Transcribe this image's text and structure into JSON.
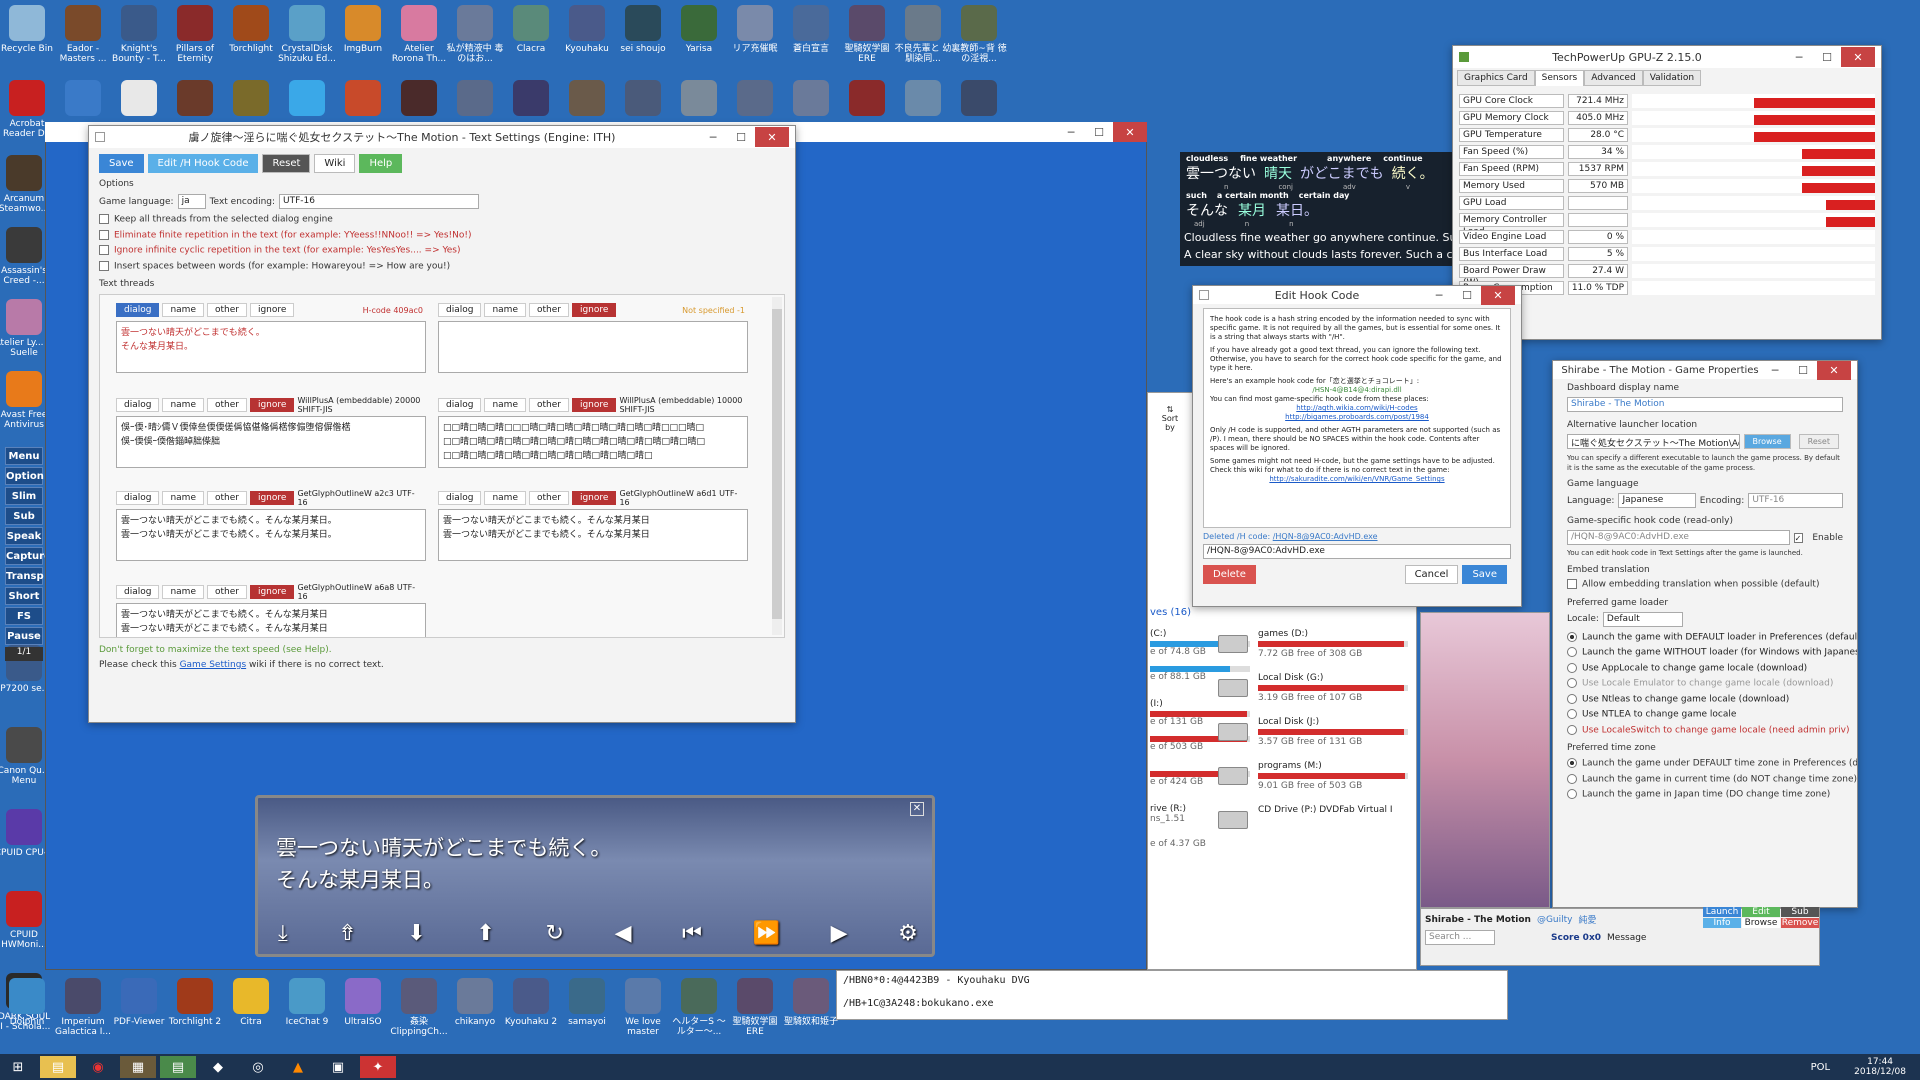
{
  "desktop": {
    "icons_top": [
      {
        "label": "Recycle Bin",
        "color": "#8fb8d8"
      },
      {
        "label": "Eador - Masters ...",
        "color": "#7a4a2a"
      },
      {
        "label": "Knight's Bounty - T...",
        "color": "#3a5a8a"
      },
      {
        "label": "Pillars of Eternity",
        "color": "#8a2a2a"
      },
      {
        "label": "Torchlight",
        "color": "#a04a1a"
      },
      {
        "label": "CrystalDisk Shizuku Ed...",
        "color": "#5aa0c8"
      },
      {
        "label": "ImgBurn",
        "color": "#d88a2a"
      },
      {
        "label": "Atelier Rorona Th...",
        "color": "#d87aa0"
      },
      {
        "label": "私が精液中 毒のはお...",
        "color": "#6a7a9a"
      },
      {
        "label": "Clacra",
        "color": "#5a8a7a"
      },
      {
        "label": "Kyouhaku",
        "color": "#4a5a8a"
      },
      {
        "label": "sei shoujo",
        "color": "#2a4a5a"
      },
      {
        "label": "Yarisa",
        "color": "#3a6a3a"
      },
      {
        "label": "リア充催眠",
        "color": "#7a8aaa"
      },
      {
        "label": "蒼白宣言",
        "color": "#4a6a9a"
      },
      {
        "label": "聖騎奴学園 ERE",
        "color": "#5a4a6a"
      },
      {
        "label": "不良先輩と 幼馴染同...",
        "color": "#6a7a8a"
      },
      {
        "label": "裏教師~背 徳の淫視...",
        "color": "#5a6a4a"
      }
    ],
    "icons_row2": [
      {
        "label": "Acrobat Reader DC",
        "color": "#c82020"
      },
      {
        "label": "",
        "color": "#3a7ac8"
      },
      {
        "label": "",
        "color": "#e8e8e8"
      },
      {
        "label": "",
        "color": "#6a3a2a"
      },
      {
        "label": "",
        "color": "#7a6a2a"
      },
      {
        "label": "",
        "color": "#3aa8e8"
      },
      {
        "label": "",
        "color": "#c84a2a"
      },
      {
        "label": "",
        "color": "#4a2a2a"
      },
      {
        "label": "",
        "color": "#5a6a8a"
      },
      {
        "label": "",
        "color": "#3a3a6a"
      },
      {
        "label": "",
        "color": "#6a5a4a"
      },
      {
        "label": "",
        "color": "#4a5a7a"
      },
      {
        "label": "",
        "color": "#7a8a9a"
      },
      {
        "label": "",
        "color": "#5a6a8a"
      },
      {
        "label": "",
        "color": "#6a7a9a"
      },
      {
        "label": "",
        "color": "#8a2a2a"
      },
      {
        "label": "",
        "color": "#6a8aaa"
      },
      {
        "label": "",
        "color": "#3a4a6a"
      }
    ],
    "icons_left": [
      {
        "label": "Arcanum Steamwo...",
        "color": "#4a3a2a"
      },
      {
        "label": "Assassin's Creed -...",
        "color": "#3a3a3a"
      },
      {
        "label": "Atelier Ly... & Suelle",
        "color": "#b87aa8"
      },
      {
        "label": "Avast Free Antivirus",
        "color": "#e87a1a"
      }
    ],
    "icons_left2": [
      {
        "label": "iP7200 se...",
        "color": "#3a5a8a"
      },
      {
        "label": "Canon Qu... Menu",
        "color": "#4a4a4a"
      },
      {
        "label": "CPUID CPU-Z",
        "color": "#5a3aa8"
      },
      {
        "label": "CPUID HWMoni...",
        "color": "#c82020"
      },
      {
        "label": "DARK SOUL II - Schola...",
        "color": "#2a2a2a"
      }
    ],
    "icons_bottom": [
      {
        "label": "Dolphin",
        "color": "#3a8ac8"
      },
      {
        "label": "Imperium Galactica I...",
        "color": "#4a4a6a"
      },
      {
        "label": "PDF-Viewer",
        "color": "#3a6ab8"
      },
      {
        "label": "Torchlight 2",
        "color": "#a03a1a"
      },
      {
        "label": "Citra",
        "color": "#e8b82a"
      },
      {
        "label": "IceChat 9",
        "color": "#4a9ac8"
      },
      {
        "label": "UltraISO",
        "color": "#8a6ac8"
      },
      {
        "label": "姦染 ClippingCh...",
        "color": "#5a5a7a"
      },
      {
        "label": "chikanyo",
        "color": "#6a7a9a"
      },
      {
        "label": "Kyouhaku 2",
        "color": "#4a5a8a"
      },
      {
        "label": "samayoi",
        "color": "#3a6a8a"
      },
      {
        "label": "We love master",
        "color": "#5a7aaa"
      },
      {
        "label": "ヘルターS 〜ルター〜...",
        "color": "#4a6a5a"
      },
      {
        "label": "聖騎奴学園 ERE",
        "color": "#5a4a6a"
      },
      {
        "label": "聖騎奴和姫子",
        "color": "#6a5a7a"
      }
    ],
    "sidebar": [
      "Menu",
      "Option",
      "Slim",
      "Sub",
      "Speak",
      "Capture",
      "Transp",
      "Short",
      "FS",
      "Pause"
    ],
    "sidebar_page": "1/1"
  },
  "textwin": {
    "title": "虜ノ旋律〜淫らに喘ぐ処女セクステット〜The Motion - Text Settings (Engine: ITH)",
    "toolbar": [
      "Save",
      "Edit /H Hook Code",
      "Reset",
      "Wiki",
      "Help"
    ],
    "options_label": "Options",
    "lang_label": "Game language:",
    "lang_val": "ja",
    "enc_label": "Text encoding:",
    "enc_val": "UTF-16",
    "checks": [
      "Keep all threads from the selected dialog engine",
      "Eliminate finite repetition in the text (for example: YYeess!!NNoo!! => Yes!No!)",
      "Ignore infinite cyclic repetition in the text (for example: YesYesYes.... => Yes)",
      "Insert spaces between words (for example: Howareyou! => How are you!)"
    ],
    "threads_label": "Text threads",
    "tabs": [
      "dialog",
      "name",
      "other",
      "ignore"
    ],
    "threads": [
      {
        "src": "H-code 409ac0",
        "lines": [
          "雲一つない晴天がどこまでも続く。",
          "そんな某月某日。"
        ],
        "red": true
      },
      {
        "src": "Not specified -1",
        "lines": [],
        "red": false
      },
      {
        "src": "WillPlusA (embeddable) 20000 SHIFT-JIS",
        "lines": [
          "俁ｰ偄･晴ｼ儔Ｖ偄倖亝偄偄傞偁恊偡偹偁楛偧傓堕傛偋偺楛",
          "俁ｰ偄俁ｰ偄偺錙晫胐偨胐"
        ],
        "red": false
      },
      {
        "src": "WillPlusA (embeddable) 10000 SHIFT-JIS",
        "lines": [
          "□□晴□晴□晴□□□晴□晴□晴□晴□晴□晴□晴□晴□□□晴□",
          "□□晴□晴□晴□晴□晴□晴□晴□晴□晴□晴□晴□晴□晴□晴□",
          "□□晴□晴□晴□晴□晴□晴□晴□晴□晴□晴□晴□"
        ],
        "red": false
      },
      {
        "src": "GetGlyphOutlineW a2c3 UTF-16",
        "lines": [
          "雲一つない晴天がどこまでも続く。そんな某月某日。",
          "雲一つない晴天がどこまでも続く。そんな某月某日。"
        ],
        "red": false
      },
      {
        "src": "GetGlyphOutlineW a6d1 UTF-16",
        "lines": [
          "雲一つない晴天がどこまでも続く。そんな某月某日",
          "雲一つない晴天がどこまでも続く。そんな某月某日"
        ],
        "red": false
      },
      {
        "src": "GetGlyphOutlineW a6a8 UTF-16",
        "lines": [
          "雲一つない晴天がどこまでも続く。そんな某月某日",
          "雲一つない晴天がどこまでも続く。そんな某月某日"
        ],
        "red": false
      }
    ],
    "foot1": "Don't forget to maximize the text speed (see Help).",
    "foot2a": "Please check this ",
    "foot2link": "Game Settings",
    "foot2b": " wiki if there is no correct text."
  },
  "game": {
    "line1": "雲一つない晴天がどこまでも続く。",
    "line2": "そんな某月某日。",
    "controls": [
      "⤓",
      "⇮",
      "⬇",
      "⬆",
      "↻",
      "◀",
      "⏮",
      "⏩",
      "▶",
      "⚙"
    ]
  },
  "overlay": {
    "ruby1": "cloudless",
    "ruby2": "fine weather",
    "ruby3": "anywhere",
    "ruby4": "continue",
    "jp1a": "雲一つない",
    "jp1b": "晴天",
    "jp1c": "がどこまでも",
    "jp1d": "続く。",
    "sub1": "n",
    "sub2": "conj",
    "sub3": "adv",
    "sub4": "v",
    "ruby5": "such",
    "ruby6": "a certain month",
    "ruby7": "certain day",
    "jp2a": "そんな",
    "jp2b": "某月",
    "jp2c": "某日。",
    "sub5": "adj",
    "sub6": "n",
    "sub7": "n",
    "tr1": "Cloudless fine weather go anywhere continue. Such a certain month certain day.",
    "tr2": "A clear sky without clouds lasts forever. Such a certain month certain day."
  },
  "gpuz": {
    "title": "TechPowerUp GPU-Z 2.15.0",
    "tabs": [
      "Graphics Card",
      "Sensors",
      "Advanced",
      "Validation"
    ],
    "rows": [
      {
        "n": "GPU Core Clock",
        "v": "721.4 MHz",
        "f": 0.5
      },
      {
        "n": "GPU Memory Clock",
        "v": "405.0 MHz",
        "f": 0.5
      },
      {
        "n": "GPU Temperature",
        "v": "28.0 °C",
        "f": 0.5
      },
      {
        "n": "Fan Speed (%)",
        "v": "34 %",
        "f": 0.3
      },
      {
        "n": "Fan Speed (RPM)",
        "v": "1537 RPM",
        "f": 0.3
      },
      {
        "n": "Memory Used",
        "v": "570 MB",
        "f": 0.3
      },
      {
        "n": "GPU Load",
        "v": "",
        "f": 0.2
      },
      {
        "n": "Memory Controller Load",
        "v": "",
        "f": 0.2
      },
      {
        "n": "Video Engine Load",
        "v": "0 %",
        "f": 0.0
      },
      {
        "n": "Bus Interface Load",
        "v": "5 %",
        "f": 0.0
      },
      {
        "n": "Board Power Draw (W)",
        "v": "27.4 W",
        "f": 0.0
      },
      {
        "n": "Power Consumption (%)",
        "v": "11.0 % TDP",
        "f": 0.0
      }
    ]
  },
  "hook": {
    "title": "Edit Hook Code",
    "p1": "The hook code is a hash string encoded by the information needed to sync with specific game. It is not required by all the games, but is essential for some ones. It is a string that always starts with \"/H\".",
    "p2": "If you have already got a good text thread, you can ignore the following text. Otherwise, you have to search for the correct hook code specific for the game, and type it here.",
    "p3": "Here's an example hook code for「恋と選挙とチョコレート」:",
    "p3code": "/HSN-4@B14@4:dirapi.dll",
    "p4": "You can find most game-specific hook code from these places:",
    "link1": "http://agth.wikia.com/wiki/H-codes",
    "link2": "http://bigames.proboards.com/post/1984",
    "p5": "Only /H code is supported, and other AGTH parameters are not supported (such as /P). I mean, there should be NO SPACES within the hook code. Contents after spaces will be ignored.",
    "p6": "Some games might not need H-code, but the game settings have to be adjusted. Check this wiki for what to do if there is no correct text in the game:",
    "link3": "http://sakuradite.com/wiki/en/VNR/Game_Settings",
    "deleted_label": "Deleted /H code:",
    "deleted_val": "/HQN-8@9AC0:AdvHD.exe",
    "code": "/HQN-8@9AC0:AdvHD.exe",
    "delete": "Delete",
    "cancel": "Cancel",
    "save": "Save"
  },
  "props": {
    "title": "Shirabe - The Motion - Game Properties",
    "display_label": "Dashboard display name",
    "display_val": "Shirabe - The Motion",
    "alt_label": "Alternative launcher location",
    "alt_val": "に喘ぐ処女セクステット〜The Motion\\AdvHD.exe",
    "browse": "Browse",
    "reset": "Reset",
    "alt_help": "You can specify a different executable to launch the game process. By default it is the same as the executable of the game process.",
    "lang_section": "Game language",
    "lang_label": "Language:",
    "lang_val": "Japanese",
    "enc_label": "Encoding:",
    "enc_val": "UTF-16",
    "hook_label": "Game-specific hook code (read-only)",
    "hook_val": "/HQN-8@9AC0:AdvHD.exe",
    "enable": "Enable",
    "hook_help": "You can edit hook code in Text Settings after the game is launched.",
    "embed_label": "Embed translation",
    "embed_chk": "Allow embedding translation when possible (default)",
    "loader_label": "Preferred game loader",
    "locale_label": "Locale:",
    "locale_val": "Default",
    "loaders": [
      {
        "t": "Launch the game with DEFAULT loader in Preferences (default)",
        "on": true,
        "c": "#222"
      },
      {
        "t": "Launch the game WITHOUT loader (for Windows with Japanese locale)",
        "on": false,
        "c": "#222"
      },
      {
        "t": "Use AppLocale to change game locale (download)",
        "on": false,
        "c": "#222"
      },
      {
        "t": "Use Locale Emulator to change game locale (download)",
        "on": false,
        "c": "#999"
      },
      {
        "t": "Use Ntleas to change game locale (download)",
        "on": false,
        "c": "#222"
      },
      {
        "t": "Use NTLEA to change game locale",
        "on": false,
        "c": "#222"
      },
      {
        "t": "Use LocaleSwitch to change game locale (need admin priv)",
        "on": false,
        "c": "#c03030"
      }
    ],
    "tz_label": "Preferred time zone",
    "tz": [
      {
        "t": "Launch the game under DEFAULT time zone in Preferences (default)",
        "on": true
      },
      {
        "t": "Launch the game in current time (do NOT change time zone)",
        "on": false
      },
      {
        "t": "Launch the game in Japan time (DO change time zone)",
        "on": false
      }
    ]
  },
  "explorer": {
    "section": "ves (16)",
    "sort": "Sort by",
    "drives": [
      {
        "name": "games (D:)",
        "free": "7.72 GB free of 308 GB",
        "fill": 0.97
      },
      {
        "name": "Local Disk (G:)",
        "free": "3.19 GB free of 107 GB",
        "fill": 0.97
      },
      {
        "name": "Local Disk (J:)",
        "free": "3.57 GB free of 131 GB",
        "fill": 0.97
      },
      {
        "name": "programs (M:)",
        "free": "9.01 GB free of 503 GB",
        "fill": 0.98
      },
      {
        "name": "CD Drive (P:) DVDFab Virtual I",
        "free": "",
        "fill": 0
      }
    ],
    "left": [
      {
        "t": "(C:)",
        "f": "e of 74.8 GB",
        "fill": 0.8
      },
      {
        "t": "",
        "f": "e of 88.1 GB",
        "fill": 0.8
      },
      {
        "t": "(I:)",
        "f": "e of 131 GB",
        "fill": 0.97
      },
      {
        "t": "",
        "f": "e of 503 GB",
        "fill": 0.97
      },
      {
        "t": "",
        "f": "e of 424 GB",
        "fill": 0.97
      },
      {
        "t": "rive (R:)",
        "f": "ns_1.51",
        "fill": 0
      },
      {
        "t": "",
        "f": "e of 4.37 GB",
        "fill": 0
      }
    ]
  },
  "vnr": {
    "title": "Shirabe - The Motion",
    "user": "@Guilty",
    "tag": "純愛",
    "search": "Search ...",
    "btns": [
      "Launch",
      "Edit",
      "Sub",
      "Info",
      "Browse",
      "Remove"
    ],
    "score": "Score 0x0",
    "message": "Message"
  },
  "hooklist": {
    "line1": "/HBN0*0:4@4423B9 - Kyouhaku DVG",
    "line2": "/HB+1C@3A248:bokukano.exe"
  },
  "taskbar": {
    "lang": "POL",
    "time": "17:44",
    "date": "2018/12/08"
  }
}
